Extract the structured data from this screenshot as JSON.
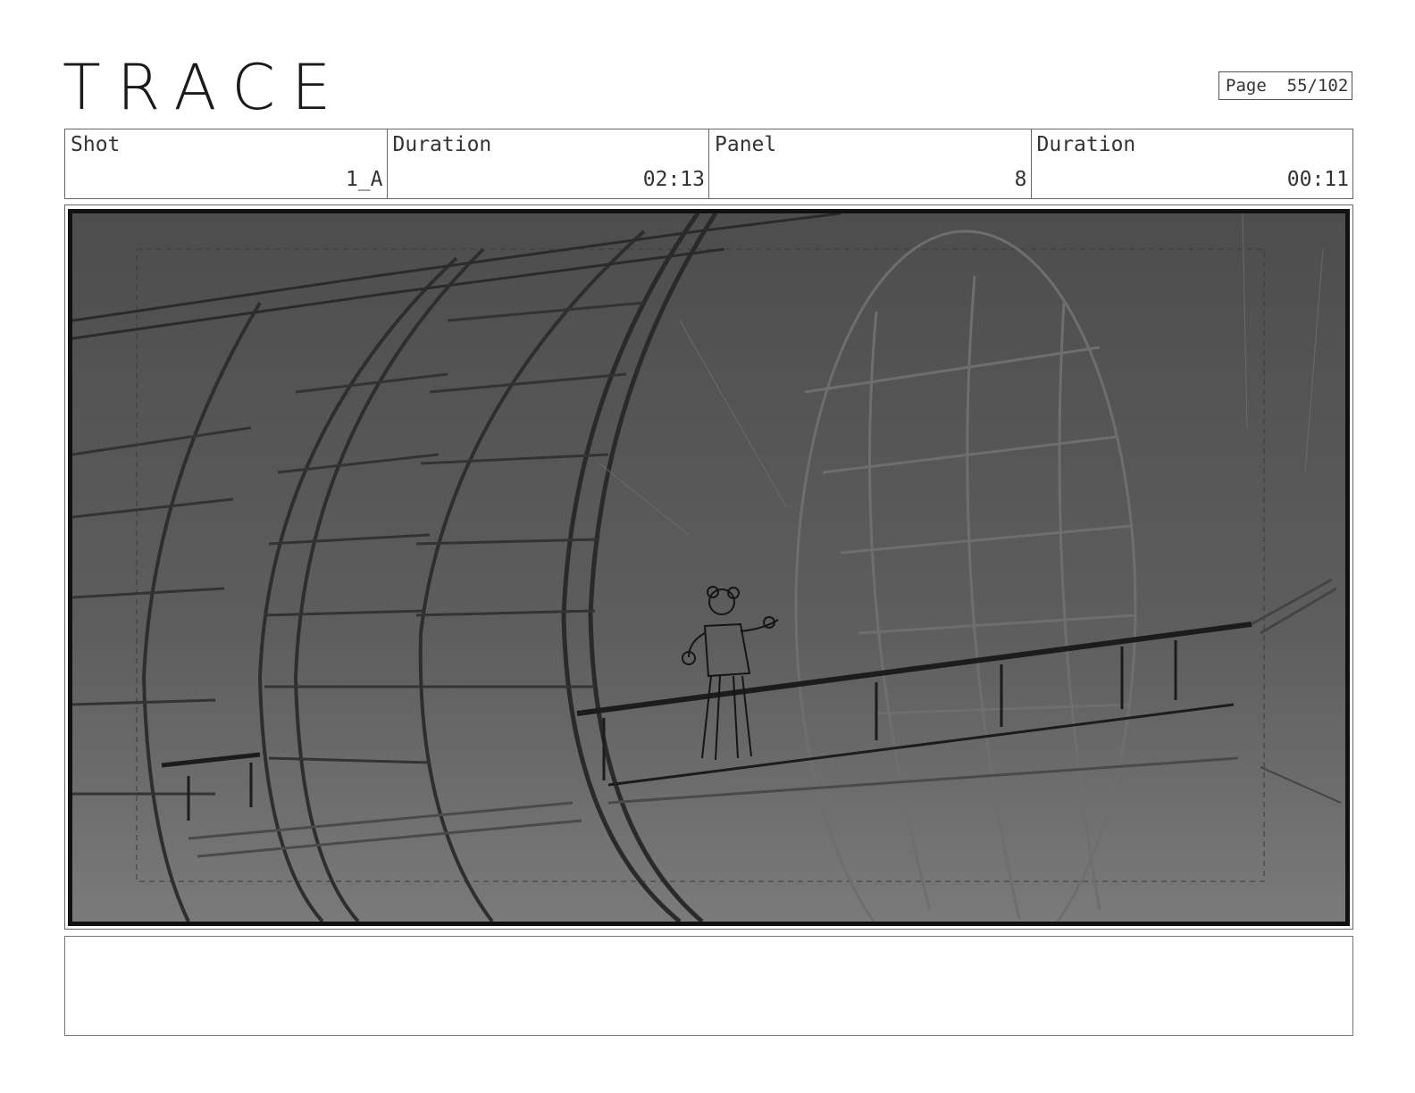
{
  "header": {
    "logo_text": "TRACE",
    "page_label": "Page",
    "page_number": "55/102"
  },
  "info": {
    "shot_label": "Shot",
    "shot_value": "1_A",
    "shot_duration_label": "Duration",
    "shot_duration_value": "02:13",
    "panel_label": "Panel",
    "panel_value": "8",
    "panel_duration_label": "Duration",
    "panel_duration_value": "00:11"
  },
  "panel_image": {
    "description_icon": "storyboard-sketch-tunnel-figure-icon"
  },
  "notes": {
    "text": ""
  }
}
